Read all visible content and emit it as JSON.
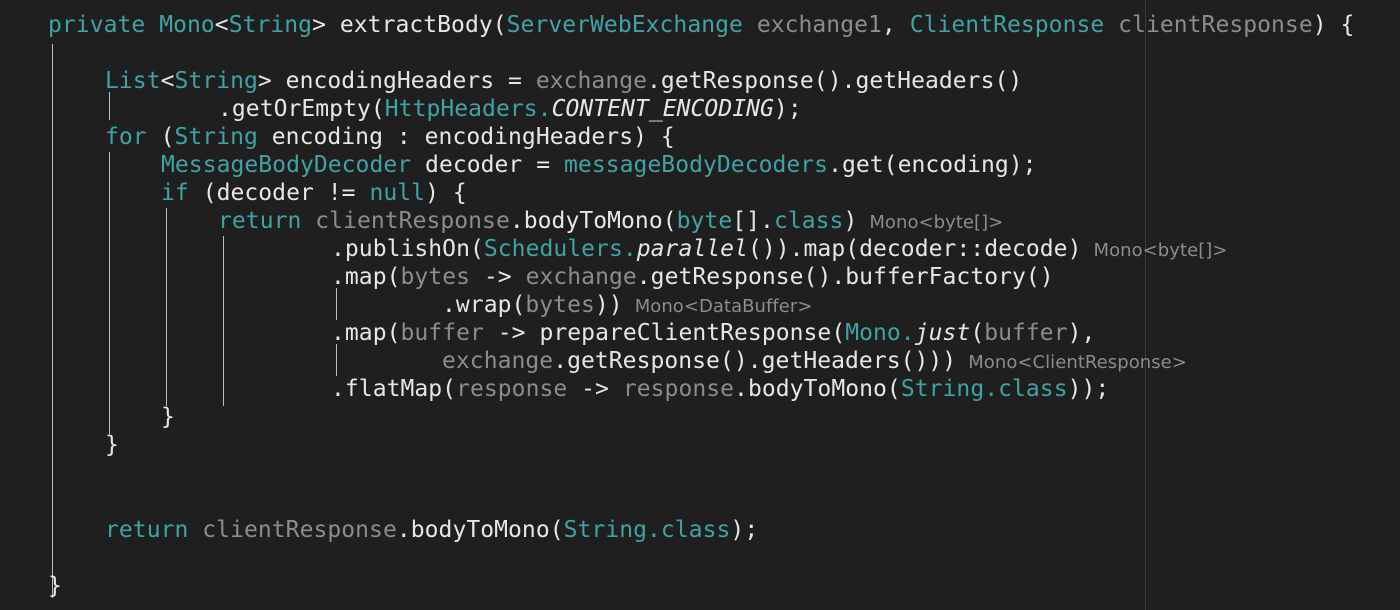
{
  "colors": {
    "background": "#1f1f1f",
    "keyword": "#3fa3a6",
    "text": "#e6e6e6",
    "dim": "#8c8c8c",
    "guide": "#bdbdbd"
  },
  "code": {
    "lines": [
      {
        "tokens": [
          {
            "t": "private ",
            "c": "kw"
          },
          {
            "t": "Mono",
            "c": "ty"
          },
          {
            "t": "<",
            "c": "pl"
          },
          {
            "t": "String",
            "c": "ty"
          },
          {
            "t": "> ",
            "c": "pl"
          },
          {
            "t": "extractBody",
            "c": "fn"
          },
          {
            "t": "(",
            "c": "pl"
          },
          {
            "t": "ServerWebExchange",
            "c": "ty"
          },
          {
            "t": " exchange1",
            "c": "dim"
          },
          {
            "t": ", ",
            "c": "pl"
          },
          {
            "t": "ClientResponse",
            "c": "ty"
          },
          {
            "t": " clientResponse",
            "c": "dim"
          },
          {
            "t": ") {",
            "c": "pl"
          }
        ]
      },
      {
        "tokens": []
      },
      {
        "tokens": [
          {
            "t": "List",
            "c": "ty"
          },
          {
            "t": "<",
            "c": "pl"
          },
          {
            "t": "String",
            "c": "ty"
          },
          {
            "t": "> encodingHeaders = ",
            "c": "pl"
          },
          {
            "t": "exchange",
            "c": "dim"
          },
          {
            "t": ".getResponse().getHeaders()",
            "c": "pl"
          }
        ]
      },
      {
        "tokens": [
          {
            "t": ".getOrEmpty(",
            "c": "pl"
          },
          {
            "t": "HttpHeaders.",
            "c": "ty"
          },
          {
            "t": "CONTENT_ENCODING",
            "c": "it"
          },
          {
            "t": ");",
            "c": "pl"
          }
        ]
      },
      {
        "tokens": [
          {
            "t": "for",
            "c": "kw"
          },
          {
            "t": " (",
            "c": "pl"
          },
          {
            "t": "String",
            "c": "ty"
          },
          {
            "t": " encoding : encodingHeaders) {",
            "c": "pl"
          }
        ]
      },
      {
        "tokens": [
          {
            "t": "MessageBodyDecoder",
            "c": "ty"
          },
          {
            "t": " decoder = ",
            "c": "pl"
          },
          {
            "t": "messageBodyDecoders",
            "c": "ty"
          },
          {
            "t": ".get(encoding);",
            "c": "pl"
          }
        ]
      },
      {
        "tokens": [
          {
            "t": "if",
            "c": "kw"
          },
          {
            "t": " (decoder != ",
            "c": "pl"
          },
          {
            "t": "null",
            "c": "kw"
          },
          {
            "t": ") {",
            "c": "pl"
          }
        ]
      },
      {
        "tokens": [
          {
            "t": "return",
            "c": "kw"
          },
          {
            "t": " clientResponse",
            "c": "dim"
          },
          {
            "t": ".bodyToMono(",
            "c": "pl"
          },
          {
            "t": "byte",
            "c": "ty"
          },
          {
            "t": "[].",
            "c": "pl"
          },
          {
            "t": "class",
            "c": "ty"
          },
          {
            "t": ")",
            "c": "pl"
          }
        ],
        "hint": "Mono<byte[]>"
      },
      {
        "tokens": [
          {
            "t": ".publishOn(",
            "c": "pl"
          },
          {
            "t": "Schedulers.",
            "c": "ty"
          },
          {
            "t": "parallel",
            "c": "it"
          },
          {
            "t": "()).map(decoder::decode)",
            "c": "pl"
          }
        ],
        "hint": "Mono<byte[]>"
      },
      {
        "tokens": [
          {
            "t": ".map(",
            "c": "pl"
          },
          {
            "t": "bytes",
            "c": "dim"
          },
          {
            "t": " -> ",
            "c": "pl"
          },
          {
            "t": "exchange",
            "c": "dim"
          },
          {
            "t": ".getResponse().bufferFactory()",
            "c": "pl"
          }
        ]
      },
      {
        "tokens": [
          {
            "t": ".wrap(",
            "c": "pl"
          },
          {
            "t": "bytes",
            "c": "dim"
          },
          {
            "t": "))",
            "c": "pl"
          }
        ],
        "hint": "Mono<DataBuffer>"
      },
      {
        "tokens": [
          {
            "t": ".map(",
            "c": "pl"
          },
          {
            "t": "buffer",
            "c": "dim"
          },
          {
            "t": " -> prepareClientResponse(",
            "c": "pl"
          },
          {
            "t": "Mono.",
            "c": "ty"
          },
          {
            "t": "just",
            "c": "it"
          },
          {
            "t": "(",
            "c": "pl"
          },
          {
            "t": "buffer",
            "c": "dim"
          },
          {
            "t": "),",
            "c": "pl"
          }
        ]
      },
      {
        "tokens": [
          {
            "t": "exchange",
            "c": "dim"
          },
          {
            "t": ".getResponse().getHeaders()))",
            "c": "pl"
          }
        ],
        "hint": "Mono<ClientResponse>"
      },
      {
        "tokens": [
          {
            "t": ".flatMap(",
            "c": "pl"
          },
          {
            "t": "response",
            "c": "dim"
          },
          {
            "t": " -> ",
            "c": "pl"
          },
          {
            "t": "response",
            "c": "dim"
          },
          {
            "t": ".bodyToMono(",
            "c": "pl"
          },
          {
            "t": "String.",
            "c": "ty"
          },
          {
            "t": "class",
            "c": "ty"
          },
          {
            "t": "));",
            "c": "pl"
          }
        ]
      },
      {
        "tokens": [
          {
            "t": "}",
            "c": "pl"
          }
        ]
      },
      {
        "tokens": [
          {
            "t": "}",
            "c": "pl"
          }
        ]
      },
      {
        "tokens": []
      },
      {
        "tokens": []
      },
      {
        "tokens": [
          {
            "t": "return",
            "c": "kw"
          },
          {
            "t": " clientResponse",
            "c": "dim"
          },
          {
            "t": ".bodyToMono(",
            "c": "pl"
          },
          {
            "t": "String.",
            "c": "ty"
          },
          {
            "t": "class",
            "c": "ty"
          },
          {
            "t": ");",
            "c": "pl"
          }
        ]
      },
      {
        "tokens": []
      },
      {
        "tokens": [
          {
            "t": "}",
            "c": "pl"
          }
        ]
      }
    ]
  }
}
